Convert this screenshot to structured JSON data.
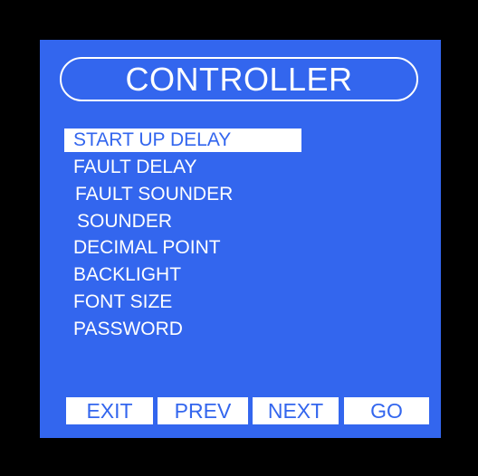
{
  "screen": {
    "title": "CONTROLLER",
    "menu": [
      {
        "label": "START UP DELAY",
        "selected": true
      },
      {
        "label": "FAULT DELAY",
        "selected": false
      },
      {
        "label": "FAULT SOUNDER",
        "selected": false
      },
      {
        "label": "SOUNDER",
        "selected": false
      },
      {
        "label": "DECIMAL POINT",
        "selected": false
      },
      {
        "label": "BACKLIGHT",
        "selected": false
      },
      {
        "label": "FONT SIZE",
        "selected": false
      },
      {
        "label": "PASSWORD",
        "selected": false
      }
    ],
    "buttons": {
      "exit": "EXIT",
      "prev": "PREV",
      "next": "NEXT",
      "go": "GO"
    }
  },
  "colors": {
    "screen_background": "#3366ee",
    "bezel": "#000000",
    "text": "#ffffff",
    "highlight_background": "#ffffff",
    "highlight_text": "#3366ee"
  }
}
